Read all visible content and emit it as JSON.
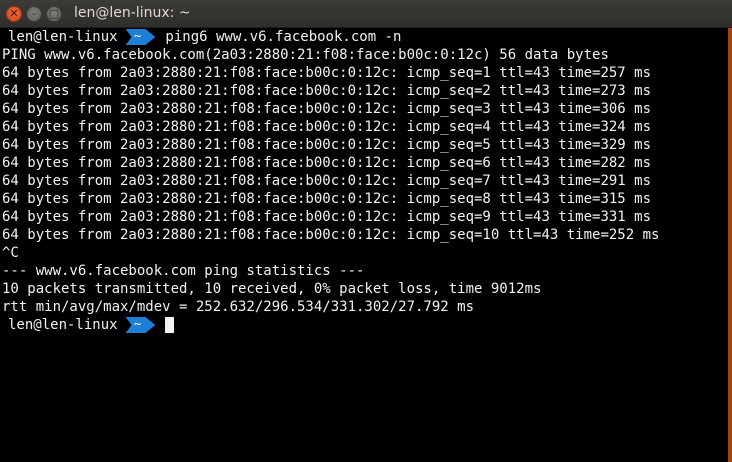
{
  "window": {
    "title": "len@len-linux: ~",
    "close_glyph": "✕",
    "minimize_glyph": "–",
    "maximize_glyph": "□"
  },
  "prompt": {
    "user": "len@len-linux",
    "dir": "~",
    "accent_color": "#1e7fd6"
  },
  "terminal": {
    "command": "ping6 www.v6.facebook.com -n",
    "lines": [
      "PING www.v6.facebook.com(2a03:2880:21:f08:face:b00c:0:12c) 56 data bytes",
      "64 bytes from 2a03:2880:21:f08:face:b00c:0:12c: icmp_seq=1 ttl=43 time=257 ms",
      "64 bytes from 2a03:2880:21:f08:face:b00c:0:12c: icmp_seq=2 ttl=43 time=273 ms",
      "64 bytes from 2a03:2880:21:f08:face:b00c:0:12c: icmp_seq=3 ttl=43 time=306 ms",
      "64 bytes from 2a03:2880:21:f08:face:b00c:0:12c: icmp_seq=4 ttl=43 time=324 ms",
      "64 bytes from 2a03:2880:21:f08:face:b00c:0:12c: icmp_seq=5 ttl=43 time=329 ms",
      "64 bytes from 2a03:2880:21:f08:face:b00c:0:12c: icmp_seq=6 ttl=43 time=282 ms",
      "64 bytes from 2a03:2880:21:f08:face:b00c:0:12c: icmp_seq=7 ttl=43 time=291 ms",
      "64 bytes from 2a03:2880:21:f08:face:b00c:0:12c: icmp_seq=8 ttl=43 time=315 ms",
      "64 bytes from 2a03:2880:21:f08:face:b00c:0:12c: icmp_seq=9 ttl=43 time=331 ms",
      "64 bytes from 2a03:2880:21:f08:face:b00c:0:12c: icmp_seq=10 ttl=43 time=252 ms",
      "^C",
      "--- www.v6.facebook.com ping statistics ---",
      "10 packets transmitted, 10 received, 0% packet loss, time 9012ms",
      "rtt min/avg/max/mdev = 252.632/296.534/331.302/27.792 ms"
    ]
  }
}
